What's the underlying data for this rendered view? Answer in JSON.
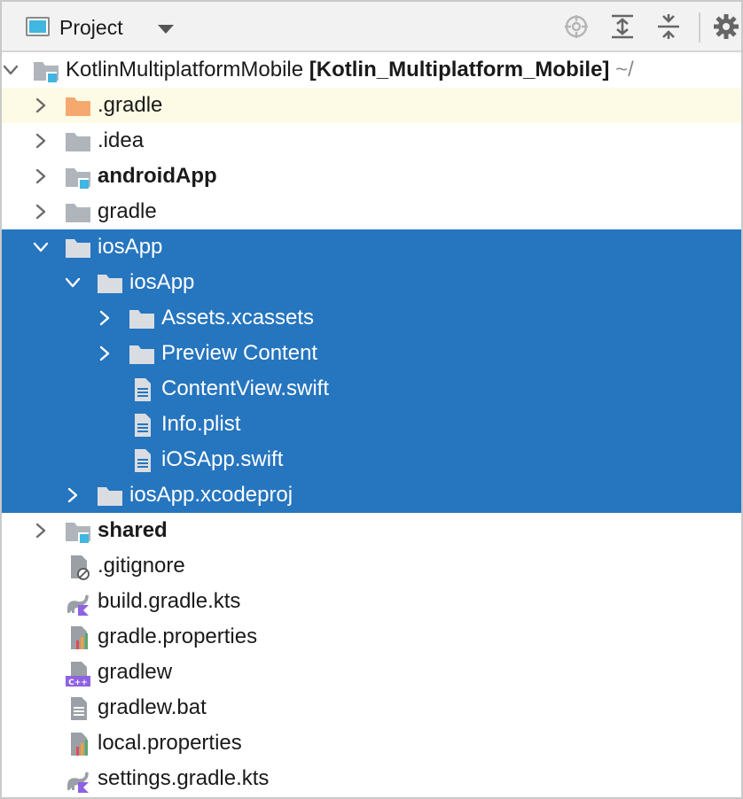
{
  "toolbar": {
    "view_label": "Project",
    "icons": [
      "select-opened-file-icon",
      "expand-all-icon",
      "collapse-all-icon",
      "settings-gear-icon"
    ]
  },
  "colors": {
    "selection": "#2675bf",
    "highlight_row": "#fdfbe5",
    "folder_gray": "#b0b5bb",
    "folder_orange": "#f6a96f",
    "module_badge": "#40b6e0"
  },
  "tree": {
    "root": {
      "name": "KotlinMultiplatformMobile",
      "module": "[Kotlin_Multiplatform_Mobile]",
      "path_tail": "~/"
    },
    "items": [
      {
        "label": ".gradle"
      },
      {
        "label": ".idea"
      },
      {
        "label": "androidApp"
      },
      {
        "label": "gradle"
      },
      {
        "label": "iosApp"
      },
      {
        "label": "iosApp"
      },
      {
        "label": "Assets.xcassets"
      },
      {
        "label": "Preview Content"
      },
      {
        "label": "ContentView.swift"
      },
      {
        "label": "Info.plist"
      },
      {
        "label": "iOSApp.swift"
      },
      {
        "label": "iosApp.xcodeproj"
      },
      {
        "label": "shared"
      },
      {
        "label": ".gitignore"
      },
      {
        "label": "build.gradle.kts"
      },
      {
        "label": "gradle.properties"
      },
      {
        "label": "gradlew"
      },
      {
        "label": "gradlew.bat"
      },
      {
        "label": "local.properties"
      },
      {
        "label": "settings.gradle.kts"
      }
    ]
  }
}
